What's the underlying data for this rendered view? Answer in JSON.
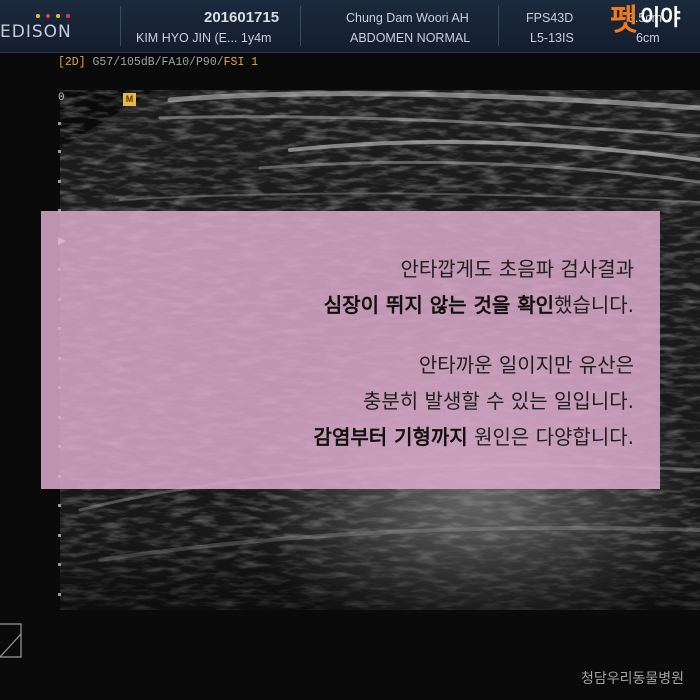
{
  "header": {
    "logo": "EDISON",
    "logo_dot_colors": [
      "#e8c030",
      "#e04040",
      "#e8c030",
      "#e04040"
    ],
    "patient_id": "201601715",
    "patient_name": "KIM HYO JIN (E... 1y4m",
    "hospital": "Chung Dam Woori AH",
    "exam": "ABDOMEN NORMAL",
    "fps": "FPS43D",
    "probe": "L5-13IS",
    "depth": "3.5cm",
    "depth_unit": "6cm",
    "brand_initial": "펫",
    "brand_rest": "이야"
  },
  "status": {
    "mode": "[2D]",
    "params": "G57/105dB/FA10/P90/",
    "fsi": "FSI 1"
  },
  "scale": {
    "zero": "0",
    "orientation_marker": "M"
  },
  "caption": {
    "paragraph1": {
      "line1": "안타깝게도 초음파 검사결과",
      "line2_bold": "심장이 뛰지 않는 것을 확인",
      "line2_rest": "했습니다."
    },
    "paragraph2": {
      "line1": "안타까운 일이지만 유산은",
      "line2": "충분히 발생할 수 있는 일입니다.",
      "line3_bold": "감염부터 기형까지",
      "line3_rest": " 원인은 다양합니다."
    }
  },
  "footer": {
    "credit": "청담우리동물병원"
  },
  "colors": {
    "header_bg": "#1c2a3e",
    "accent_orange": "#f07a22",
    "caption_bg": "#deaccc",
    "status_highlight": "#e0a540"
  }
}
